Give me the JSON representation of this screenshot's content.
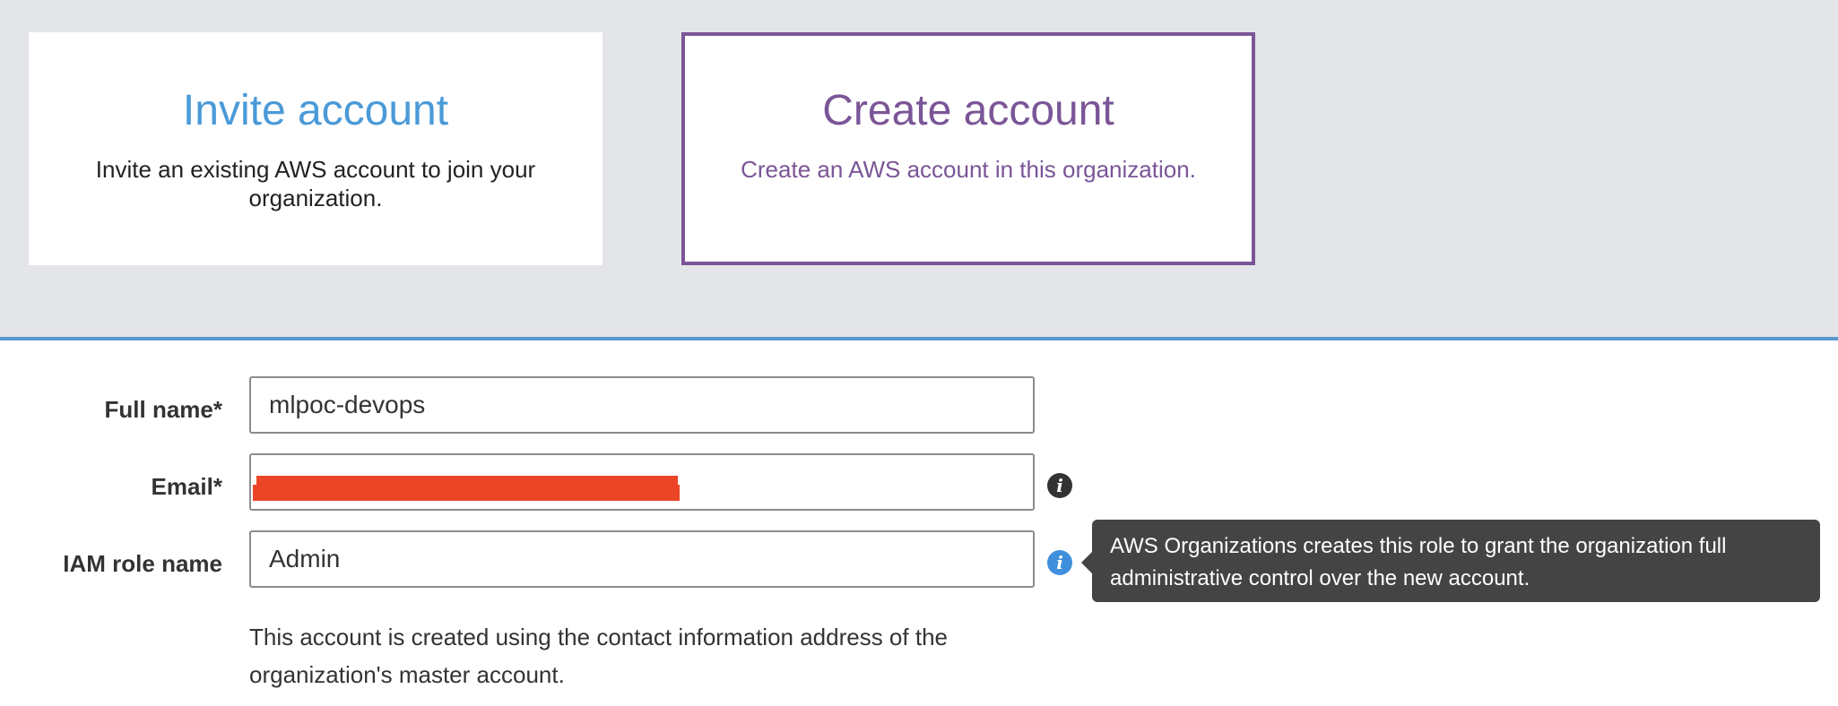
{
  "cards": {
    "invite": {
      "title": "Invite account",
      "description": "Invite an existing AWS account to join your organization."
    },
    "create": {
      "title": "Create account",
      "description": "Create an AWS account in this organization."
    }
  },
  "form": {
    "full_name": {
      "label": "Full name*",
      "value": "mlpoc-devops"
    },
    "email": {
      "label": "Email*",
      "value": "",
      "redacted": true
    },
    "iam_role": {
      "label": "IAM role name",
      "value": "Admin"
    },
    "help_text": "This account is created using the contact information address of the organization's master account."
  },
  "tooltip": {
    "text": "AWS Organizations creates this role to grant the organization full administrative control over the new account."
  },
  "icons": {
    "email_info": "info-icon",
    "iam_info": "info-icon"
  },
  "colors": {
    "band": "#e4e5e8",
    "invite_accent": "#4a9ad8",
    "create_accent": "#7a5597",
    "divider": "#5a97cd",
    "redaction": "#ec4427",
    "tooltip_bg": "#444444",
    "info_icon_default": "#333333",
    "info_icon_active": "#3f8fdc"
  }
}
